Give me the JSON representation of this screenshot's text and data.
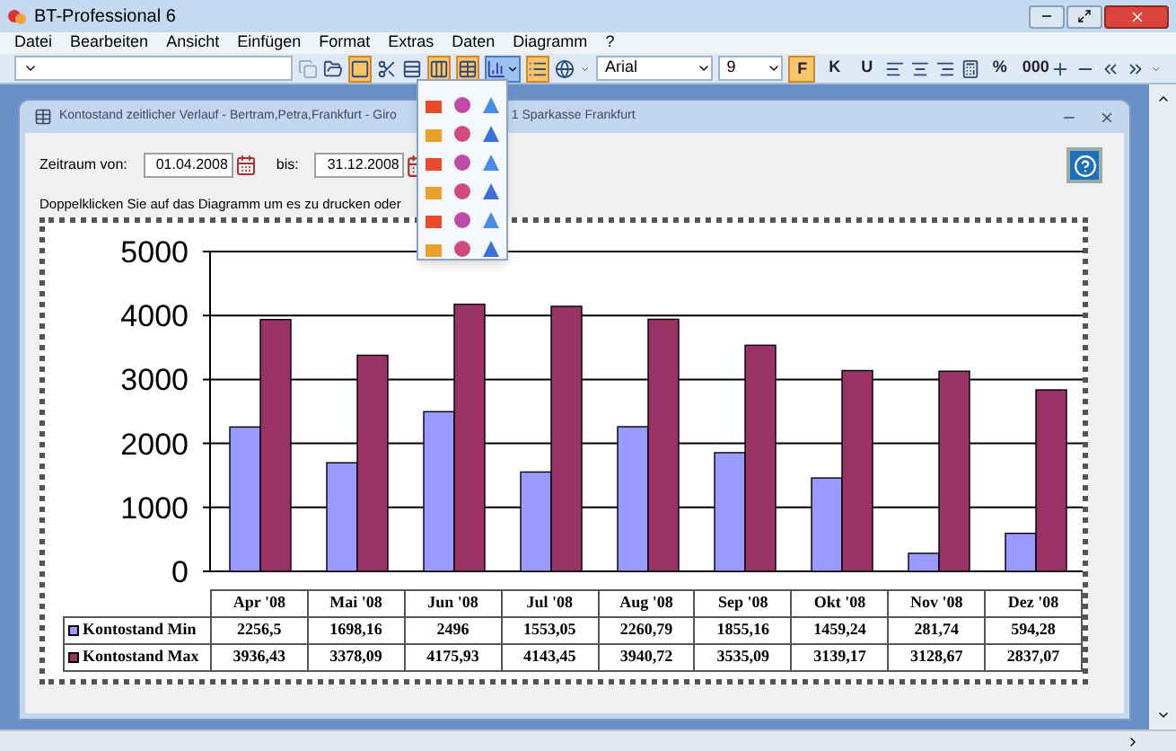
{
  "window": {
    "title": "BT-Professional 6"
  },
  "menu": [
    "Datei",
    "Bearbeiten",
    "Ansicht",
    "Einfügen",
    "Format",
    "Extras",
    "Daten",
    "Diagramm",
    "?"
  ],
  "toolbar": [
    {
      "kind": "combo"
    },
    {
      "kind": "button",
      "selected": false,
      "disabled": true
    },
    {
      "kind": "button",
      "selected": false,
      "disabled": false
    },
    {
      "kind": "button",
      "selected": true,
      "disabled": false
    },
    {
      "kind": "button",
      "selected": false,
      "disabled": false
    },
    {
      "kind": "button",
      "selected": false,
      "disabled": false
    },
    {
      "kind": "button",
      "selected": true,
      "disabled": false
    },
    {
      "kind": "button",
      "selected": true,
      "disabled": false
    },
    {
      "kind": "dropdown",
      "selected": true,
      "expanded": true
    },
    {
      "kind": "button",
      "selected": true,
      "disabled": false
    },
    {
      "kind": "button",
      "selected": false,
      "disabled": false
    },
    {
      "kind": "overflow"
    },
    {
      "kind": "combo",
      "value": "Arial"
    },
    {
      "kind": "combo",
      "value": "9"
    },
    {
      "kind": "text",
      "label": "F",
      "selected": true
    },
    {
      "kind": "text",
      "label": "K",
      "selected": false
    },
    {
      "kind": "text",
      "label": "U",
      "selected": false
    },
    {
      "kind": "button",
      "selected": false,
      "disabled": false
    },
    {
      "kind": "button",
      "selected": false,
      "disabled": false
    },
    {
      "kind": "button",
      "selected": false,
      "disabled": false
    },
    {
      "kind": "button",
      "selected": false,
      "disabled": false
    },
    {
      "kind": "text",
      "label": "%",
      "selected": false
    },
    {
      "kind": "text",
      "label": "000",
      "selected": false
    },
    {
      "kind": "button",
      "selected": false,
      "disabled": false
    },
    {
      "kind": "button",
      "selected": false,
      "disabled": false
    },
    {
      "kind": "button",
      "selected": false,
      "disabled": false
    },
    {
      "kind": "button",
      "selected": false,
      "disabled": false
    },
    {
      "kind": "overflow"
    }
  ],
  "document": {
    "title_parts": [
      "Kontostand zeitlicher Verlauf - Bertram,Petra,Frankfurt - Giro",
      "1 Sparkasse Frankfurt"
    ],
    "from_label": "Zeitraum von:",
    "from_value": "01.04.2008",
    "to_label": "bis:",
    "to_value": "31.12.2008",
    "hint": "Doppelklicken Sie auf das Diagramm um es zu drucken oder",
    "chart_data": {
      "type": "bar",
      "categories": [
        "Apr '08",
        "Mai '08",
        "Jun '08",
        "Jul '08",
        "Aug '08",
        "Sep '08",
        "Okt '08",
        "Nov '08",
        "Dez '08"
      ],
      "grid": true,
      "legend": "bottom-left",
      "ylim": [
        0,
        5000
      ],
      "yticks": [
        0,
        1000,
        2000,
        3000,
        4000,
        5000
      ],
      "series": [
        {
          "name": "Kontostand Min",
          "color": "#9999ff",
          "values": [
            2256.5,
            1698.16,
            2496,
            1553.05,
            2260.79,
            1855.16,
            1459.24,
            281.74,
            594.28
          ]
        },
        {
          "name": "Kontostand Max",
          "color": "#993366",
          "values": [
            3936.43,
            3378.09,
            4175.93,
            4143.45,
            3940.72,
            3535.09,
            3139.17,
            3128.67,
            2837.07
          ]
        }
      ]
    },
    "data_table": [
      {
        "cells": [
          "2256,5",
          "1698,16",
          "2496",
          "1553,05",
          "2260,79",
          "1855,16",
          "1459,24",
          "281,74",
          "594,28"
        ]
      },
      {
        "cells": [
          "3936,43",
          "3378,09",
          "4175,93",
          "4143,45",
          "3940,72",
          "3535,09",
          "3139,17",
          "3128,67",
          "2837,07"
        ]
      }
    ]
  }
}
